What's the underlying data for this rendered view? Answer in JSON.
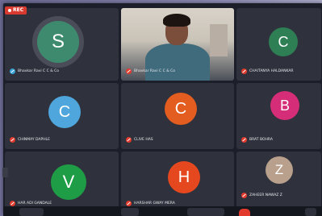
{
  "recording": {
    "label": "REC"
  },
  "tiles": [
    {
      "initial": "S",
      "name": "Bhavkar Ravi C C & Co",
      "color": "#3e8a6f",
      "mic": "on"
    },
    {
      "initial": "",
      "name": "Bhavkar Ravi C C & Co",
      "color": "",
      "mic": "off",
      "video": true
    },
    {
      "initial": "C",
      "name": "CHAITANYA HALDANKAR",
      "color": "#2f7f55",
      "mic": "off"
    },
    {
      "initial": "C",
      "name": "CHINMAY DAPHLE",
      "color": "#4fa6dd",
      "mic": "off"
    },
    {
      "initial": "C",
      "name": "CLIVE HAS",
      "color": "#e25d1f",
      "mic": "off"
    },
    {
      "initial": "B",
      "name": "BRAT BOHRA",
      "color": "#d62d78",
      "mic": "off"
    },
    {
      "initial": "V",
      "name": "HAR ADI GANDALE",
      "color": "#1f9d46",
      "mic": "off"
    },
    {
      "initial": "H",
      "name": "HARSHAR GWAY MERA",
      "color": "#e5481f",
      "mic": "off"
    },
    {
      "initial": "Z",
      "name": "ZAHEER NAWAZ Z",
      "color": "#b8a08c",
      "mic": "off"
    }
  ]
}
